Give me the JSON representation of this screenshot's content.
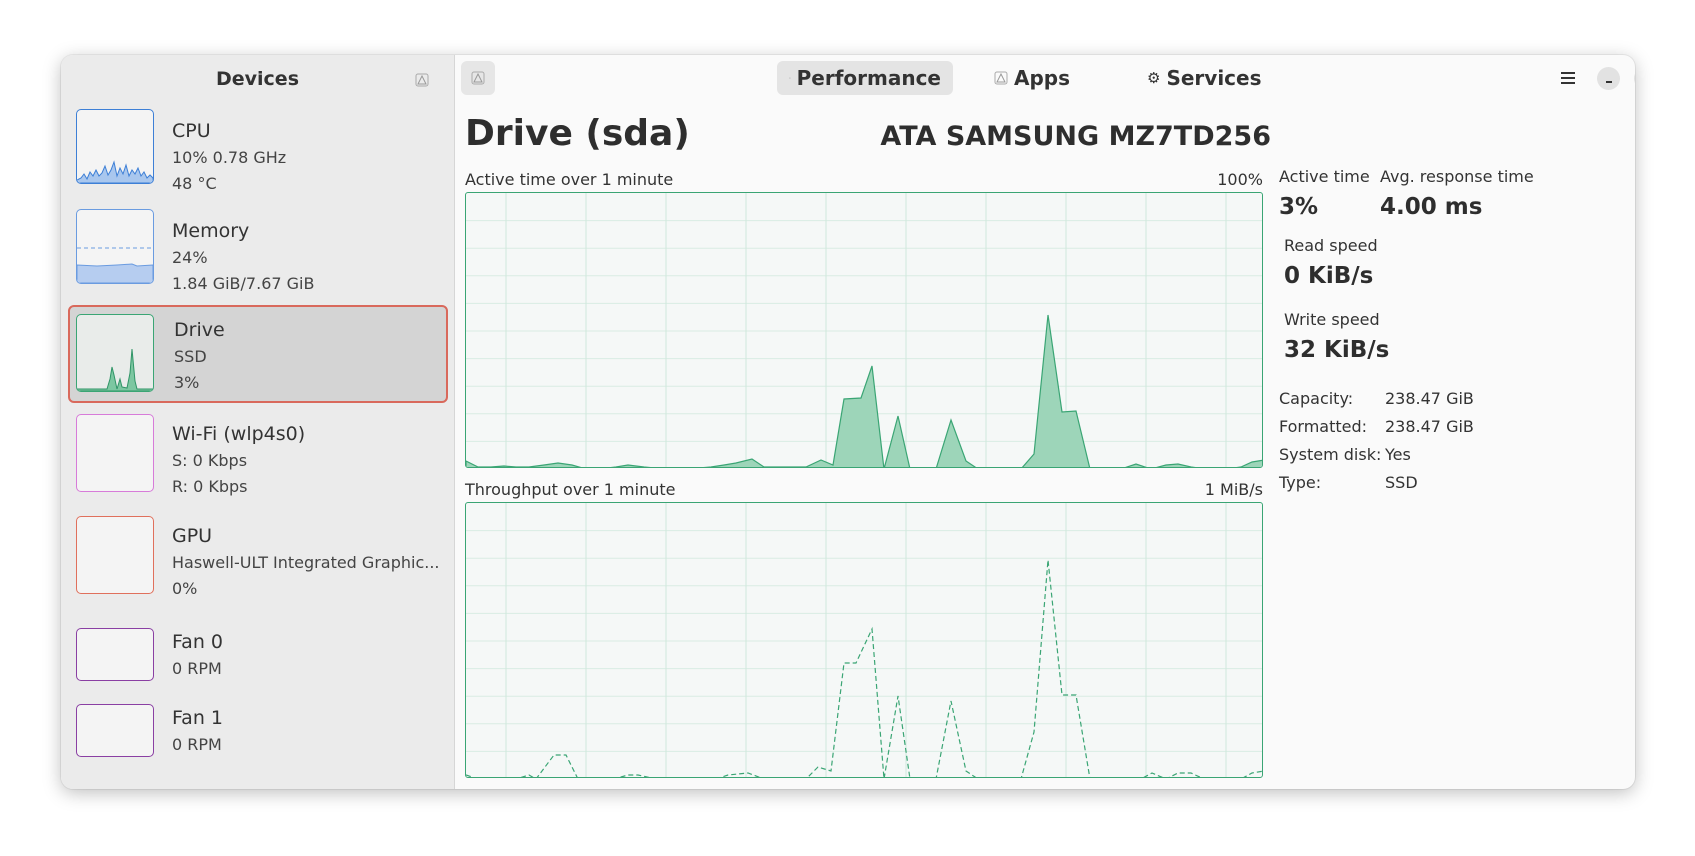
{
  "sidebar": {
    "title": "Devices",
    "items": [
      {
        "name": "CPU",
        "line1": "10% 0.78 GHz",
        "line2": "48 °C",
        "color": "#3d7fd6"
      },
      {
        "name": "Memory",
        "line1": "24%",
        "line2": "1.84 GiB/7.67 GiB",
        "color": "#6a9be0"
      },
      {
        "name": "Drive",
        "line1": "SSD",
        "line2": "3%",
        "color": "#3aa574"
      },
      {
        "name": "Wi-Fi (wlp4s0)",
        "line1": "S: 0 Kbps",
        "line2": "R: 0 Kbps",
        "color": "#d77bd9"
      },
      {
        "name": "GPU",
        "line1": "Haswell-ULT Integrated Graphic...",
        "line2": "0%",
        "color": "#e0705c"
      },
      {
        "name": "Fan 0",
        "line1": "0 RPM",
        "color": "#8a3fa3"
      },
      {
        "name": "Fan 1",
        "line1": "0 RPM",
        "color": "#8a3fa3"
      }
    ]
  },
  "tabs": [
    {
      "label": "Performance",
      "icon": "warning-icon"
    },
    {
      "label": "Apps",
      "icon": "warning-icon"
    },
    {
      "label": "Services",
      "icon": "gear-icon"
    }
  ],
  "main": {
    "title": "Drive (sda)",
    "model": "ATA SAMSUNG MZ7TD256",
    "graph1": {
      "label": "Active time over 1 minute",
      "max": "100%"
    },
    "graph2": {
      "label": "Throughput over 1 minute",
      "max": "1 MiB/s"
    },
    "stats": {
      "active_time_label": "Active time",
      "active_time_value": "3%",
      "response_label": "Avg. response time",
      "response_value": "4.00 ms",
      "read_label": "Read speed",
      "read_value": "0 KiB/s",
      "write_label": "Write speed",
      "write_value": "32 KiB/s"
    },
    "details": [
      {
        "key": "Capacity:",
        "value": "238.47 GiB"
      },
      {
        "key": "Formatted:",
        "value": "238.47 GiB"
      },
      {
        "key": "System disk:",
        "value": "Yes"
      },
      {
        "key": "Type:",
        "value": "SSD"
      }
    ]
  },
  "accent": "#3aa574",
  "selection_border": "#d9695c"
}
